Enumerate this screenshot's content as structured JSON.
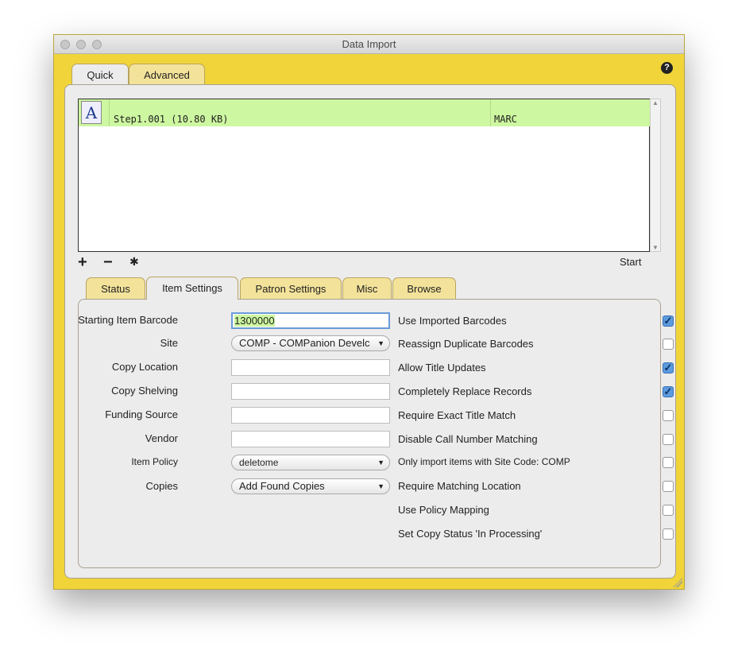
{
  "window": {
    "title": "Data Import"
  },
  "top_tabs": [
    {
      "label": "Quick",
      "active": true
    },
    {
      "label": "Advanced",
      "active": false
    }
  ],
  "file_list": [
    {
      "name": "Step1.001  (10.80 KB)",
      "format": "MARC",
      "icon": "marc8-file-icon"
    }
  ],
  "toolbar": {
    "add": "+",
    "remove": "−",
    "action": "gear-icon",
    "start": "Start"
  },
  "sub_tabs": [
    {
      "label": "Status"
    },
    {
      "label": "Item Settings",
      "active": true
    },
    {
      "label": "Patron Settings"
    },
    {
      "label": "Misc"
    },
    {
      "label": "Browse"
    }
  ],
  "fields": [
    {
      "label": "Starting Item Barcode",
      "value": "1300000",
      "type": "text"
    },
    {
      "label": "Site",
      "value": "COMP - COMPanion Develc",
      "type": "select"
    },
    {
      "label": "Copy Location",
      "value": "",
      "type": "text"
    },
    {
      "label": "Copy Shelving",
      "value": "",
      "type": "text"
    },
    {
      "label": "Funding Source",
      "value": "",
      "type": "text"
    },
    {
      "label": "Vendor",
      "value": "",
      "type": "text"
    },
    {
      "label": "Item Policy",
      "value": "deletome",
      "type": "select"
    },
    {
      "label": "Copies",
      "value": "Add Found Copies",
      "type": "select"
    }
  ],
  "options": [
    {
      "label": "Use Imported Barcodes",
      "checked": true
    },
    {
      "label": "Reassign Duplicate Barcodes",
      "checked": false
    },
    {
      "label": "Allow Title Updates",
      "checked": true
    },
    {
      "label": "Completely Replace Records",
      "checked": true
    },
    {
      "label": "Require Exact Title Match",
      "checked": false
    },
    {
      "label": "Disable Call Number Matching",
      "checked": false
    },
    {
      "label": "Only import items with Site Code: COMP",
      "checked": false
    },
    {
      "label": "Require Matching Location",
      "checked": false
    },
    {
      "label": "Use Policy Mapping",
      "checked": false
    },
    {
      "label": "Set Copy Status 'In Processing'",
      "checked": false
    }
  ],
  "colors": {
    "window_bg": "#f0d43a",
    "selected_row": "#cdf7a0"
  }
}
